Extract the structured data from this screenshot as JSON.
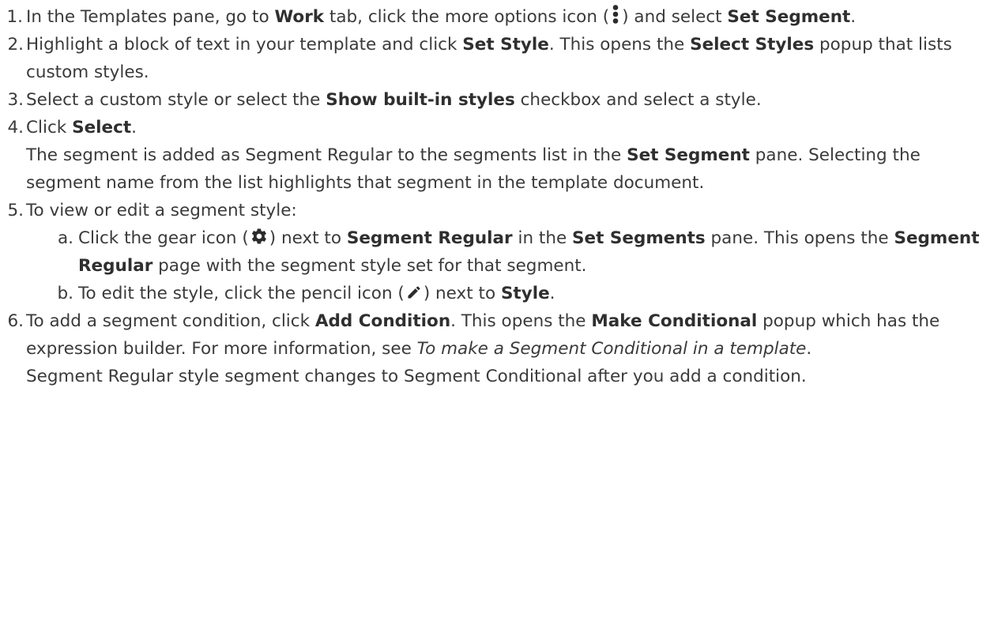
{
  "steps": [
    {
      "num": "1.",
      "lead": "In the Templates pane, go to ",
      "work": "Work",
      "mid": " tab, click the more options icon (",
      "icon": "vertical-ellipsis-icon",
      "after": ") and select ",
      "set_segment": "Set Segment",
      "end": "."
    },
    {
      "num": "2.",
      "lead": "Highlight a block of text in your template and click ",
      "set_style": "Set Style",
      "mid": ". This opens the ",
      "select_styles": "Select Styles",
      "end": " popup that lists custom styles."
    },
    {
      "num": "3.",
      "lead": "Select a custom style or select the ",
      "show_builtin": "Show built-in styles",
      "end": " checkbox and select a style."
    },
    {
      "num": "4.",
      "lead": "Click ",
      "select": "Select",
      "end": ".",
      "p2_lead": "The segment is added as Segment Regular to the segments list in the ",
      "p2_bold": "Set Segment",
      "p2_end": " pane. Selecting the segment name from the list highlights that segment in the template document."
    },
    {
      "num": "5.",
      "text": "To view or edit a segment style:",
      "subs": [
        {
          "letter": "a.",
          "lead": "Click the gear icon (",
          "icon": "gear-icon",
          "mid1": ") next to ",
          "bold1": "Segment Regular",
          "mid2": " in the ",
          "bold2": "Set Segments",
          "mid3": " pane. This opens the ",
          "bold3": "Segment Regular",
          "end": " page with the segment style set for that segment."
        },
        {
          "letter": "b.",
          "lead": "To edit the style, click the pencil icon (",
          "icon": "pencil-icon",
          "mid": ") next to ",
          "bold": "Style",
          "end": "."
        }
      ]
    },
    {
      "num": "6.",
      "lead": "To add a segment condition, click ",
      "add_condition": "Add Condition",
      "mid": ". This opens the ",
      "make_conditional": "Make Conditional",
      "mid2": " popup which has the expression builder. For more information, see ",
      "link": "To make a Segment Conditional in a template",
      "end": ".",
      "p2": "Segment Regular style segment changes to Segment Conditional after you add a condition."
    }
  ],
  "colors": {
    "text": "#3a3a3a",
    "icon": "#2b2b2b"
  }
}
